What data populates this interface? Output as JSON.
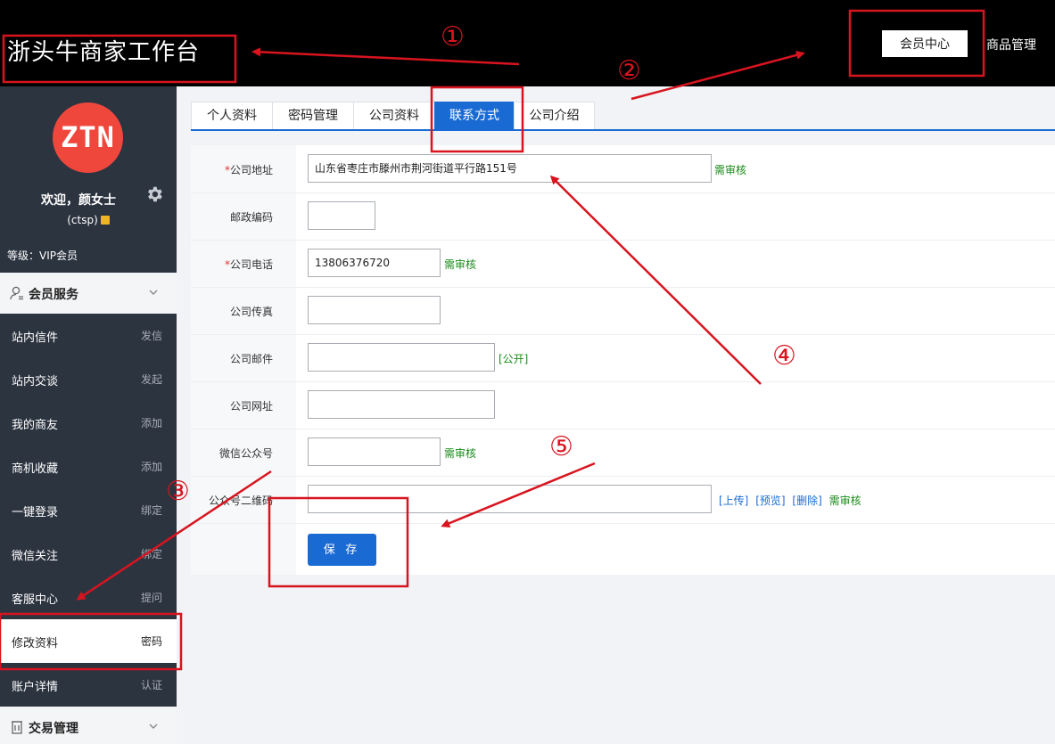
{
  "header": {
    "title": "浙头牛商家工作台",
    "member_center": "会员中心",
    "goods_manage": "商品管理"
  },
  "sidebar": {
    "avatar_text": "ZTN",
    "welcome": "欢迎，颜女士",
    "username": "(ctsp)",
    "level": "等级：VIP会员",
    "section_member": "会员服务",
    "items": [
      {
        "label": "站内信件",
        "action": "发信"
      },
      {
        "label": "站内交谈",
        "action": "发起"
      },
      {
        "label": "我的商友",
        "action": "添加"
      },
      {
        "label": "商机收藏",
        "action": "添加"
      },
      {
        "label": "一键登录",
        "action": "绑定"
      },
      {
        "label": "微信关注",
        "action": "绑定"
      },
      {
        "label": "客服中心",
        "action": "提问"
      },
      {
        "label": "修改资料",
        "action": "密码"
      },
      {
        "label": "账户详情",
        "action": "认证"
      }
    ],
    "section_trade": "交易管理"
  },
  "tabs": [
    "个人资料",
    "密码管理",
    "公司资料",
    "联系方式",
    "公司介绍"
  ],
  "form": {
    "address_label": "公司地址",
    "address_value": "山东省枣庄市滕州市荆河街道平行路151号",
    "address_note": "需审核",
    "zip_label": "邮政编码",
    "zip_value": "",
    "phone_label": "公司电话",
    "phone_value": "13806376720",
    "phone_note": "需审核",
    "fax_label": "公司传真",
    "fax_value": "",
    "email_label": "公司邮件",
    "email_value": "",
    "email_note": "[公开]",
    "web_label": "公司网址",
    "web_value": "",
    "wechat_label": "微信公众号",
    "wechat_value": "",
    "wechat_note": "需审核",
    "qr_label": "公众号二维码",
    "qr_value": "",
    "qr_upload": "[上传]",
    "qr_preview": "[预览]",
    "qr_delete": "[删除]",
    "qr_note": "需审核",
    "save": "保 存",
    "required_mark": "*"
  },
  "annotations": [
    "①",
    "②",
    "③",
    "④",
    "⑤"
  ],
  "colors": {
    "header_bg": "#000000",
    "sidebar_bg": "#2c3440",
    "primary": "#1a6ad4",
    "avatar": "#f0473d",
    "annotation": "#d8141f",
    "note_green": "#1a8b1a"
  }
}
